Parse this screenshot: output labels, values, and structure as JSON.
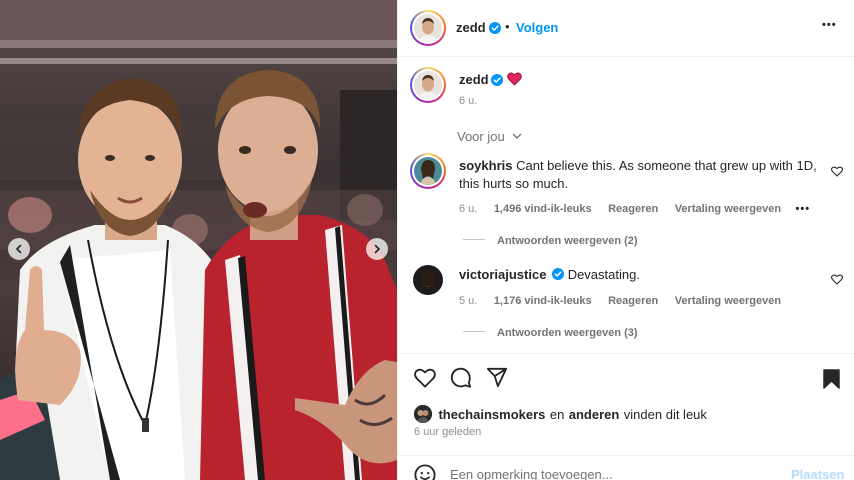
{
  "post": {
    "username": "zedd",
    "follow_label": "Volgen",
    "more_label": "•••",
    "caption_user": "zedd",
    "caption_time": "6 u.",
    "sort_label": "Voor jou"
  },
  "comments": [
    {
      "user": "soykhris",
      "text_line1": "Cant believe this. As someone that grew up with 1D,",
      "text_line2": "this hurts so much.",
      "time": "6 u.",
      "likes": "1,496 vind-ik-leuks",
      "reply": "Reageren",
      "translate": "Vertaling weergeven",
      "more": "•••",
      "view_replies": "Antwoorden weergeven (2)"
    },
    {
      "user": "victoriajustice",
      "text_line1": "Devastating.",
      "time": "5 u.",
      "likes": "1,176 vind-ik-leuks",
      "reply": "Reageren",
      "translate": "Vertaling weergeven",
      "view_replies": "Antwoorden weergeven (3)"
    }
  ],
  "likes": {
    "liker": "thechainsmokers",
    "connector": "en",
    "others": "anderen",
    "suffix": "vinden dit leuk",
    "time": "6 uur geleden"
  },
  "composer": {
    "placeholder": "Een opmerking toevoegen...",
    "post_label": "Plaatsen"
  },
  "colors": {
    "accent": "#0095f6",
    "verified": "#0095f6",
    "heart": "#e0245e"
  }
}
